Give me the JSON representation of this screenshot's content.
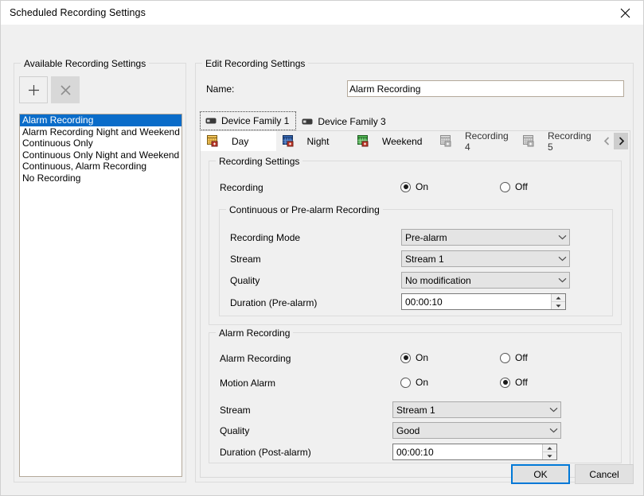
{
  "window": {
    "title": "Scheduled Recording Settings",
    "close_icon": "close-icon"
  },
  "left_panel": {
    "title": "Available Recording Settings",
    "add_button": {
      "icon": "plus-icon",
      "label": "+"
    },
    "delete_button": {
      "icon": "cross-icon",
      "label": "×",
      "disabled": true
    },
    "list": {
      "items": [
        "Alarm Recording",
        "Alarm Recording Night and Weekend",
        "Continuous Only",
        "Continuous Only Night and Weekend",
        "Continuous, Alarm Recording",
        "No Recording"
      ],
      "selected_index": 0,
      "selected_value": "Alarm Recording"
    }
  },
  "right_panel": {
    "title": "Edit Recording Settings",
    "name_label": "Name:",
    "name_value": "Alarm Recording",
    "name_placeholder": "",
    "device_family_tabs": [
      {
        "label": "Device Family 1",
        "icon": "device-icon",
        "active": true
      },
      {
        "label": "Device Family 3",
        "icon": "device-icon",
        "active": false
      }
    ],
    "schedule_tabs": [
      {
        "label": "Day",
        "icon": "schedule-day-icon",
        "active": true,
        "dim": false
      },
      {
        "label": "Night",
        "icon": "schedule-night-icon",
        "active": false,
        "dim": false
      },
      {
        "label": "Weekend",
        "icon": "schedule-weekend-icon",
        "active": false,
        "dim": false
      },
      {
        "label": "Recording 4",
        "icon": "schedule-icon",
        "active": false,
        "dim": true
      },
      {
        "label": "Recording 5",
        "icon": "schedule-icon",
        "active": false,
        "dim": true
      }
    ],
    "tab_scroll": {
      "prev_icon": "chevron-left-icon",
      "next_icon": "chevron-right-icon"
    }
  },
  "recording_settings": {
    "group_title": "Recording Settings",
    "recording": {
      "label": "Recording",
      "on_label": "On",
      "off_label": "Off",
      "value": "On"
    }
  },
  "continuous_group": {
    "group_title": "Continuous or Pre-alarm Recording",
    "recording_mode": {
      "label": "Recording Mode",
      "value": "Pre-alarm"
    },
    "stream": {
      "label": "Stream",
      "value": "Stream 1"
    },
    "quality": {
      "label": "Quality",
      "value": "No modification"
    },
    "duration": {
      "label": "Duration (Pre-alarm)",
      "value": "00:00:10"
    }
  },
  "alarm_group": {
    "group_title": "Alarm Recording",
    "alarm_recording": {
      "label": "Alarm Recording",
      "on_label": "On",
      "off_label": "Off",
      "value": "On"
    },
    "motion_alarm": {
      "label": "Motion Alarm",
      "on_label": "On",
      "off_label": "Off",
      "value": "Off"
    },
    "stream": {
      "label": "Stream",
      "value": "Stream 1"
    },
    "quality": {
      "label": "Quality",
      "value": "Good"
    },
    "duration": {
      "label": "Duration (Post-alarm)",
      "value": "00:00:10"
    }
  },
  "footer": {
    "ok_label": "OK",
    "cancel_label": "Cancel"
  },
  "colors": {
    "dialog_bg": "#f0f0f0",
    "titlebar_bg": "#ffffff",
    "selection_blue": "#0a6cc9",
    "focus_blue": "#0078d7",
    "field_border": "#b4a99a"
  }
}
